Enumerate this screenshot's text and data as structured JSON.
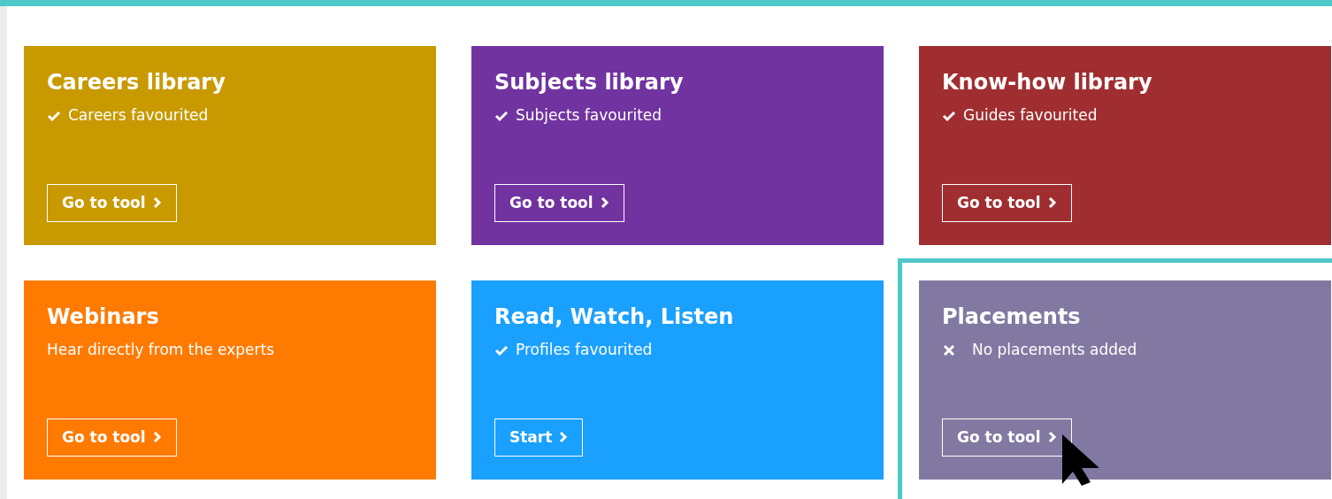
{
  "cards": [
    {
      "title": "Careers library",
      "status": "Careers favourited",
      "kind": "check",
      "button": "Go to tool",
      "color": "#c89a00",
      "highlighted": false
    },
    {
      "title": "Subjects library",
      "status": "Subjects favourited",
      "kind": "check",
      "button": "Go to tool",
      "color": "#7133a0",
      "highlighted": false
    },
    {
      "title": "Know-how library",
      "status": "Guides favourited",
      "kind": "check",
      "button": "Go to tool",
      "color": "#a02e30",
      "highlighted": false
    },
    {
      "title": "Webinars",
      "status": "Hear directly from the experts",
      "kind": "plain",
      "button": "Go to tool",
      "color": "#ff7a00",
      "highlighted": false
    },
    {
      "title": "Read, Watch, Listen",
      "status": "Profiles favourited",
      "kind": "check",
      "button": "Start",
      "color": "#1aa0ff",
      "highlighted": false
    },
    {
      "title": "Placements",
      "status": "No placements added",
      "kind": "cross",
      "button": "Go to tool",
      "color": "#8279a2",
      "highlighted": true
    }
  ]
}
